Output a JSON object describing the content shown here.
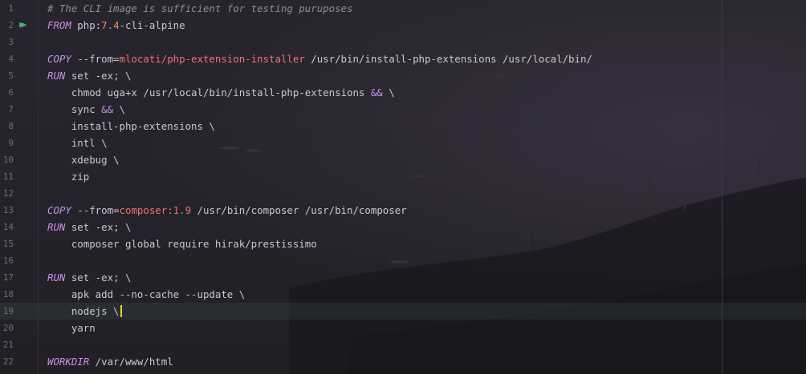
{
  "editor": {
    "language": "Dockerfile",
    "current_line": 19,
    "run_icon": "run-gutter-icon",
    "colors": {
      "keyword": "#c792ea",
      "string": "#f07178",
      "number": "#f78c6c",
      "comment": "#8f8d9a",
      "text": "#c9c7d0",
      "line_number": "#6e6b78",
      "caret": "#e6d21a"
    },
    "lines": [
      {
        "num": "1",
        "tokens": [
          {
            "t": "comment",
            "v": "# The CLI image is sufficient for testing puruposes"
          }
        ]
      },
      {
        "num": "2",
        "run_icon": true,
        "tokens": [
          {
            "t": "kw",
            "v": "FROM"
          },
          {
            "t": "text",
            "v": " php:"
          },
          {
            "t": "num",
            "v": "7.4"
          },
          {
            "t": "text",
            "v": "-cli-alpine"
          }
        ]
      },
      {
        "num": "3",
        "tokens": []
      },
      {
        "num": "4",
        "tokens": [
          {
            "t": "kw",
            "v": "COPY"
          },
          {
            "t": "text",
            "v": " --from="
          },
          {
            "t": "str",
            "v": "mlocati/php-extension-installer"
          },
          {
            "t": "text",
            "v": " /usr/bin/install-php-extensions /usr/local/bin/"
          }
        ]
      },
      {
        "num": "5",
        "tokens": [
          {
            "t": "kw",
            "v": "RUN"
          },
          {
            "t": "text",
            "v": " set -ex; \\"
          }
        ]
      },
      {
        "num": "6",
        "tokens": [
          {
            "t": "text",
            "v": "    chmod uga+x /usr/local/bin/install-php-extensions "
          },
          {
            "t": "amp",
            "v": "&&"
          },
          {
            "t": "text",
            "v": " \\"
          }
        ]
      },
      {
        "num": "7",
        "tokens": [
          {
            "t": "text",
            "v": "    sync "
          },
          {
            "t": "amp",
            "v": "&&"
          },
          {
            "t": "text",
            "v": " \\"
          }
        ]
      },
      {
        "num": "8",
        "tokens": [
          {
            "t": "text",
            "v": "    install-php-extensions \\"
          }
        ]
      },
      {
        "num": "9",
        "tokens": [
          {
            "t": "text",
            "v": "    intl \\"
          }
        ]
      },
      {
        "num": "10",
        "tokens": [
          {
            "t": "text",
            "v": "    xdebug \\"
          }
        ]
      },
      {
        "num": "11",
        "tokens": [
          {
            "t": "text",
            "v": "    zip"
          }
        ]
      },
      {
        "num": "12",
        "tokens": []
      },
      {
        "num": "13",
        "tokens": [
          {
            "t": "kw",
            "v": "COPY"
          },
          {
            "t": "text",
            "v": " --from="
          },
          {
            "t": "str",
            "v": "composer:1.9"
          },
          {
            "t": "text",
            "v": " /usr/bin/composer /usr/bin/composer"
          }
        ]
      },
      {
        "num": "14",
        "tokens": [
          {
            "t": "kw",
            "v": "RUN"
          },
          {
            "t": "text",
            "v": " set -ex; \\"
          }
        ]
      },
      {
        "num": "15",
        "tokens": [
          {
            "t": "text",
            "v": "    composer global require hirak/prestissimo"
          }
        ]
      },
      {
        "num": "16",
        "tokens": []
      },
      {
        "num": "17",
        "tokens": [
          {
            "t": "kw",
            "v": "RUN"
          },
          {
            "t": "text",
            "v": " set -ex; \\"
          }
        ]
      },
      {
        "num": "18",
        "tokens": [
          {
            "t": "text",
            "v": "    apk add --no-cache --update \\"
          }
        ]
      },
      {
        "num": "19",
        "caret": true,
        "tokens": [
          {
            "t": "text",
            "v": "    nodejs \\"
          }
        ]
      },
      {
        "num": "20",
        "tokens": [
          {
            "t": "text",
            "v": "    yarn"
          }
        ]
      },
      {
        "num": "21",
        "tokens": []
      },
      {
        "num": "22",
        "tokens": [
          {
            "t": "kw",
            "v": "WORKDIR"
          },
          {
            "t": "text",
            "v": " /var/www/html"
          }
        ]
      }
    ]
  }
}
